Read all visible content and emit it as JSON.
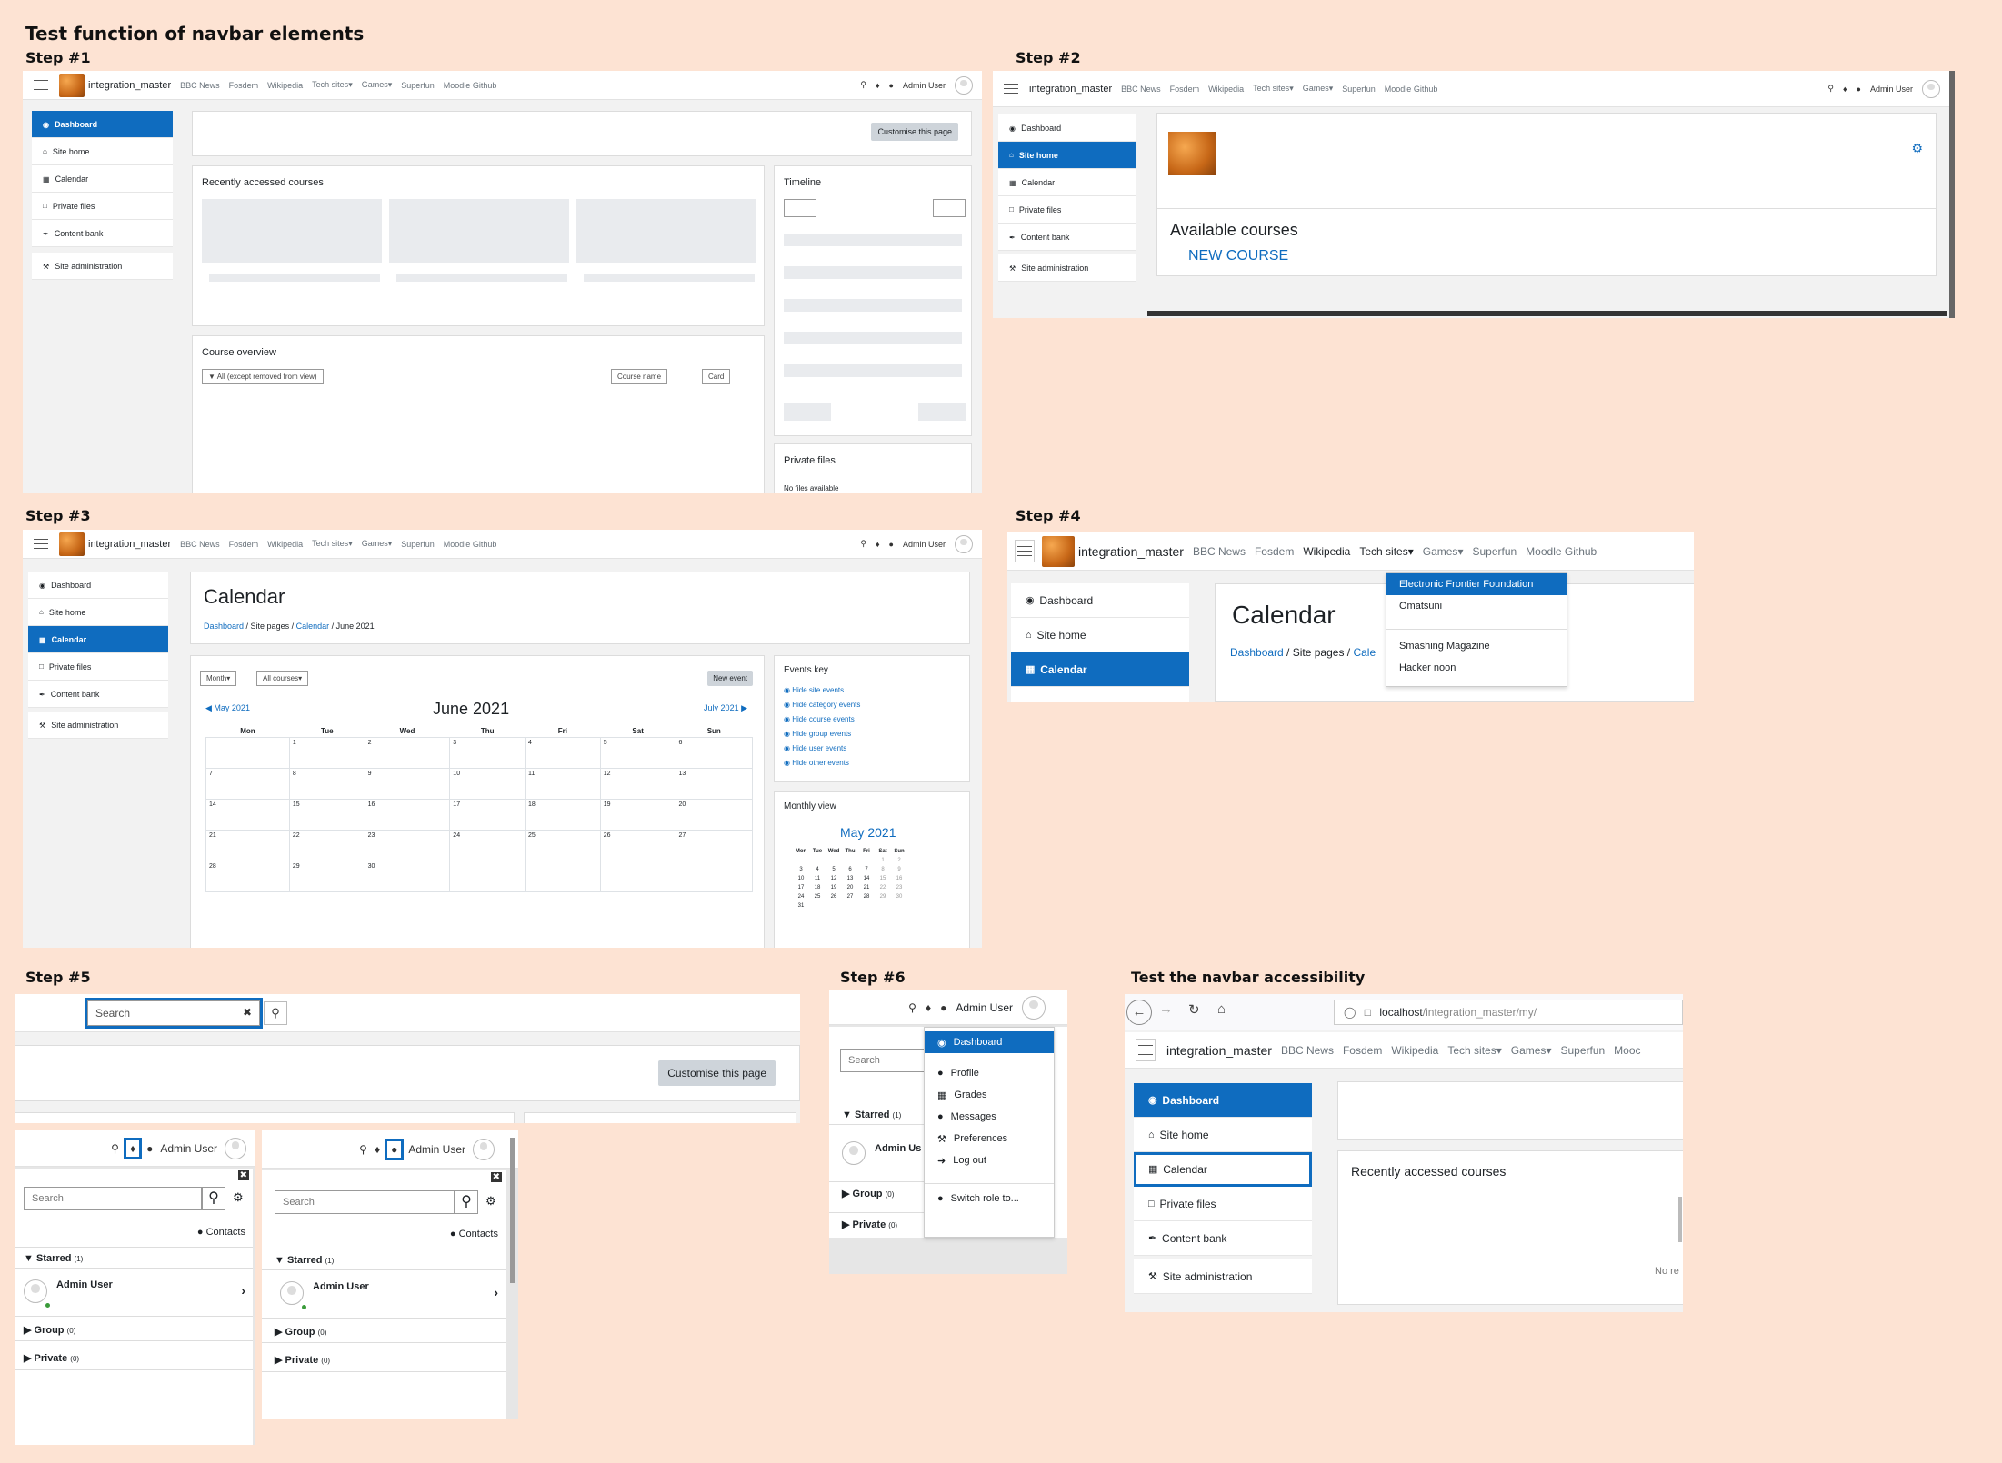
{
  "title": "Test function of navbar elements",
  "steps": {
    "s1": "Step #1",
    "s2": "Step #2",
    "s3": "Step #3",
    "s4": "Step #4",
    "s5": "Step #5",
    "s6": "Step #6",
    "acc": "Test the navbar accessibility"
  },
  "nav": {
    "site": "integration_master",
    "links": [
      "BBC News",
      "Fosdem",
      "Wikipedia",
      "Tech sites",
      "Games",
      "Superfun",
      "Moodle Github"
    ],
    "user": "Admin User",
    "caret": "▾"
  },
  "side": [
    "Dashboard",
    "Site home",
    "Calendar",
    "Private files",
    "Content bank",
    "Site administration"
  ],
  "s1": {
    "customise": "Customise this page",
    "recent": "Recently accessed courses",
    "timeline": "Timeline",
    "overview": "Course overview",
    "filter": "All (except removed from view)",
    "sort": "Course name",
    "view": "Card",
    "private_files": "Private files",
    "no_files": "No files available"
  },
  "s2": {
    "available": "Available courses",
    "new_course": "NEW COURSE"
  },
  "s3": {
    "heading": "Calendar",
    "crumbs": [
      "Dashboard",
      "Site pages",
      "Calendar",
      "June 2021"
    ],
    "month": "Month",
    "all_courses": "All courses",
    "new_event": "New event",
    "prev": "May 2021",
    "cur": "June 2021",
    "next": "July 2021",
    "days": [
      "Mon",
      "Tue",
      "Wed",
      "Thu",
      "Fri",
      "Sat",
      "Sun"
    ],
    "weeks": [
      [
        "",
        "1",
        "2",
        "3",
        "4",
        "5",
        "6"
      ],
      [
        "7",
        "8",
        "9",
        "10",
        "11",
        "12",
        "13"
      ],
      [
        "14",
        "15",
        "16",
        "17",
        "18",
        "19",
        "20"
      ],
      [
        "21",
        "22",
        "23",
        "24",
        "25",
        "26",
        "27"
      ],
      [
        "28",
        "29",
        "30",
        "",
        "",
        "",
        ""
      ]
    ],
    "events_key": "Events key",
    "events": [
      "Hide site events",
      "Hide category events",
      "Hide course events",
      "Hide group events",
      "Hide user events",
      "Hide other events"
    ],
    "monthly_view": "Monthly view",
    "mini_month": "May 2021",
    "mini_days": [
      "Mon",
      "Tue",
      "Wed",
      "Thu",
      "Fri",
      "Sat",
      "Sun"
    ],
    "mini_weeks": [
      [
        "",
        "",
        "",
        "",
        "",
        "1",
        "2"
      ],
      [
        "3",
        "4",
        "5",
        "6",
        "7",
        "8",
        "9"
      ],
      [
        "10",
        "11",
        "12",
        "13",
        "14",
        "15",
        "16"
      ],
      [
        "17",
        "18",
        "19",
        "20",
        "21",
        "22",
        "23"
      ],
      [
        "24",
        "25",
        "26",
        "27",
        "28",
        "29",
        "30"
      ],
      [
        "31",
        "",
        "",
        "",
        "",
        "",
        ""
      ]
    ]
  },
  "s4": {
    "menu": [
      "Electronic Frontier Foundation",
      "Omatsuni",
      "Smashing Magazine",
      "Hacker noon"
    ],
    "heading": "Calendar",
    "crumbs": [
      "Dashboard",
      "Site pages",
      "Cale"
    ]
  },
  "s5": {
    "search_value": "Search",
    "customise": "Customise this page",
    "drawer_search": "Search",
    "contacts": "Contacts",
    "starred": "Starred",
    "starred_count": "(1)",
    "contact_name": "Admin User",
    "group": "Group",
    "group_count": "(0)",
    "private": "Private",
    "private_count": "(0)"
  },
  "s6": {
    "user": "Admin User",
    "search": "Search",
    "menu": [
      "Dashboard",
      "Profile",
      "Grades",
      "Messages",
      "Preferences",
      "Log out",
      "Switch role to..."
    ],
    "starred": "Starred",
    "starred_count": "(1)",
    "contact": "Admin Us",
    "group": "Group",
    "group_count": "(0)",
    "private": "Private",
    "private_count": "(0)"
  },
  "acc": {
    "url_host": "localhost",
    "url_path": "/integration_master/my/",
    "recent": "Recently accessed courses",
    "no_re": "No re",
    "last_link": "Mooc"
  },
  "icons": {
    "menu": "hamburger-icon",
    "search": "search-icon",
    "bell": "bell-icon",
    "chat": "chat-icon",
    "dashboard": "dashboard-icon",
    "home": "home-icon",
    "calendar": "calendar-icon",
    "file": "file-icon",
    "brush": "brush-icon",
    "wrench": "wrench-icon",
    "gear": "gear-icon",
    "close": "close-icon"
  },
  "colors": {
    "background": "#fde3d3",
    "accent": "#0f6cbf"
  }
}
